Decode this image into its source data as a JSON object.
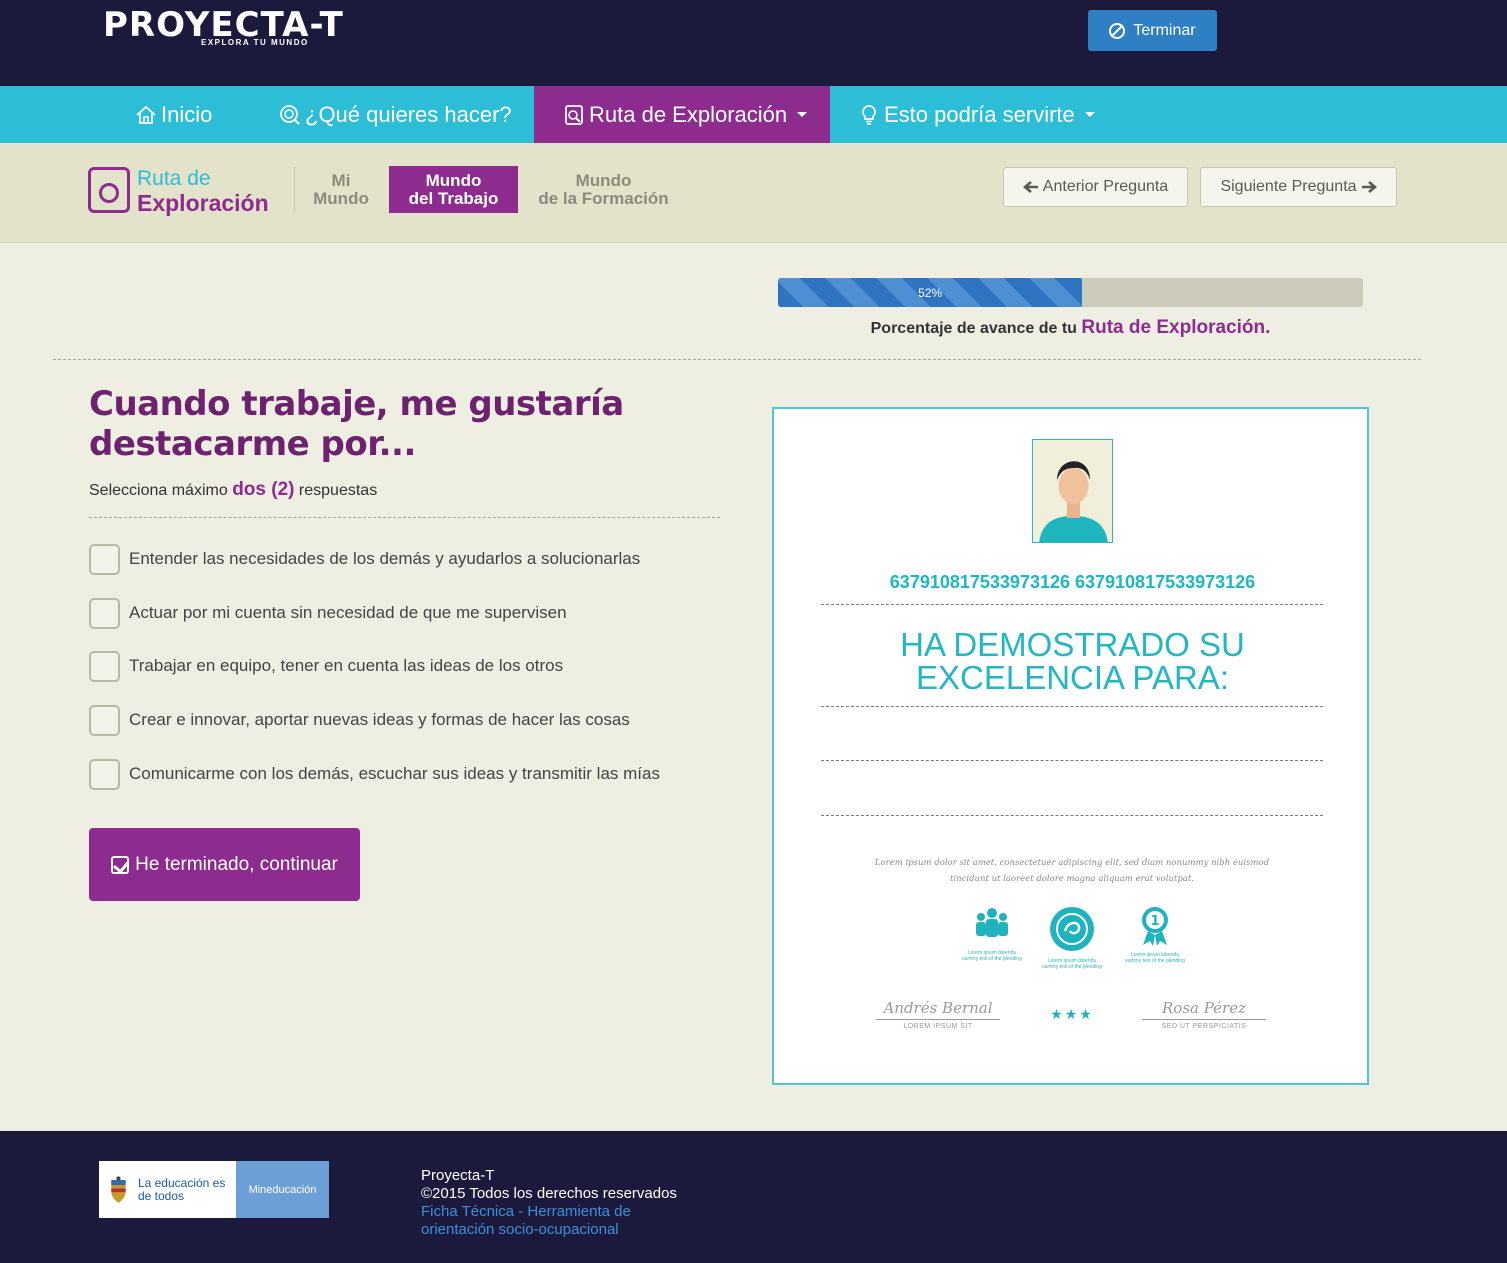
{
  "header": {
    "logo_main": "PROYECTA-T",
    "logo_sub": "EXPLORA TU MUNDO",
    "terminar_label": "Terminar"
  },
  "nav": {
    "items": [
      {
        "label": "Inicio"
      },
      {
        "label": "¿Qué quieres hacer?"
      },
      {
        "label": "Ruta de Exploración"
      },
      {
        "label": "Esto podría servirte"
      }
    ]
  },
  "subheader": {
    "title_line1": "Ruta de",
    "title_line2": "Exploración",
    "tabs": [
      {
        "line1": "Mi",
        "line2": "Mundo"
      },
      {
        "line1": "Mundo",
        "line2": "del Trabajo"
      },
      {
        "line1": "Mundo",
        "line2": "de la Formación"
      }
    ],
    "prev_label": "Anterior Pregunta",
    "next_label": "Siguiente Pregunta"
  },
  "progress": {
    "value": 52,
    "label": "52%",
    "caption_prefix": "Porcentaje de avance de tu",
    "caption_highlight": "Ruta de Exploración."
  },
  "question": {
    "title": "Cuando trabaje, me gustaría destacarme por...",
    "instruction_prefix": "Selecciona máximo",
    "instruction_highlight": "dos (2)",
    "instruction_suffix": "respuestas",
    "options": [
      "Entender las necesidades de los demás y ayudarlos a solucionarlas",
      "Actuar por mi cuenta sin necesidad de que me supervisen",
      "Trabajar en equipo, tener en cuenta las ideas de los otros",
      "Crear e innovar, aportar nuevas ideas y formas de hacer las cosas",
      "Comunicarme con los demás, escuchar sus ideas y transmitir las mías"
    ],
    "continue_label": "He terminado, continuar"
  },
  "certificate": {
    "code": "637910817533973126 637910817533973126",
    "heading_line1": "HA DEMOSTRADO SU",
    "heading_line2": "EXCELENCIA PARA:",
    "lorem": "Lorem ipsum dolor sit amet, consectetuer adipiscing elit, sed diam nonummy nibh euismod tincidunt ut laoreet dolore magna aliquam erat volutpat.",
    "icon_caption": "Lorem ipsum bibendu summy text of the plending",
    "sig_left_name": "Andrés Bernal",
    "sig_left_role": "LOREM IPSUM SIT",
    "sig_right_name": "Rosa Pérez",
    "sig_right_role": "SED UT PERSPICIATIS",
    "stars": "★★★"
  },
  "footer": {
    "badge_left": "La educación es de todos",
    "badge_right": "Mineducación",
    "line1": "Proyecta-T",
    "line2": "©2015 Todos los derechos reservados",
    "link": "Ficha Técnica - Herramienta de orientación socio-ocupacional"
  },
  "colors": {
    "brand_purple": "#8e2b8f",
    "brand_cyan": "#2cbed6",
    "header_navy": "#1c1a3c",
    "progress_blue": "#2e74c0"
  }
}
